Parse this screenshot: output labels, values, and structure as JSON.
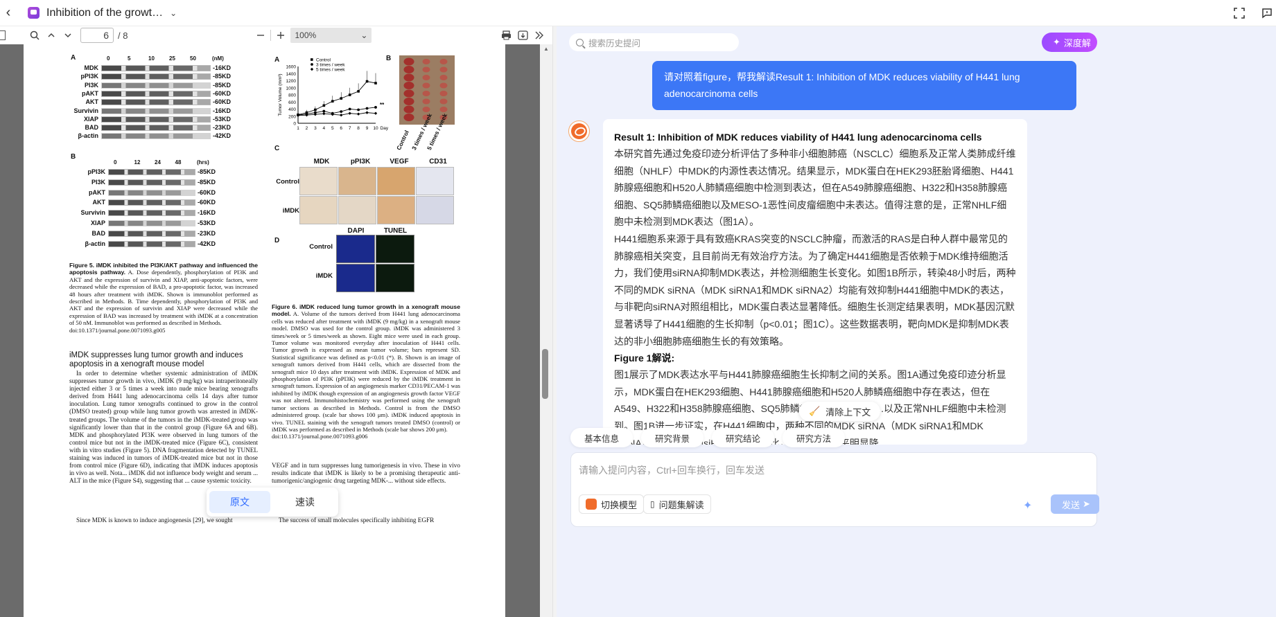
{
  "topbar": {
    "doc_title": "Inhibition of the growt…"
  },
  "pdf_toolbar": {
    "page_current": "6",
    "page_total": "/ 8",
    "zoom": "100%"
  },
  "figure5": {
    "panel_a": "A",
    "panel_b": "B",
    "doses": [
      "0",
      "5",
      "10",
      "25",
      "50",
      "(nM)"
    ],
    "rows_a": [
      {
        "name": "MDK",
        "kd": "-16KD"
      },
      {
        "name": "pPI3K",
        "kd": "-85KD"
      },
      {
        "name": "PI3K",
        "kd": "-85KD"
      },
      {
        "name": "pAKT",
        "kd": "-60KD"
      },
      {
        "name": "AKT",
        "kd": "-60KD"
      },
      {
        "name": "Survivin",
        "kd": "-16KD"
      },
      {
        "name": "XIAP",
        "kd": "-53KD"
      },
      {
        "name": "BAD",
        "kd": "-23KD"
      },
      {
        "name": "β-actin",
        "kd": "-42KD"
      }
    ],
    "times": [
      "0",
      "12",
      "24",
      "48",
      "(hrs)"
    ],
    "rows_b": [
      {
        "name": "pPI3K",
        "kd": "-85KD"
      },
      {
        "name": "PI3K",
        "kd": "-85KD"
      },
      {
        "name": "pAKT",
        "kd": "-60KD"
      },
      {
        "name": "AKT",
        "kd": "-60KD"
      },
      {
        "name": "Survivin",
        "kd": "-16KD"
      },
      {
        "name": "XIAP",
        "kd": "-53KD"
      },
      {
        "name": "BAD",
        "kd": "-23KD"
      },
      {
        "name": "β-actin",
        "kd": "-42KD"
      }
    ],
    "caption_title": "Figure 5. iMDK inhibited the PI3K/AKT pathway and influenced the apoptosis pathway.",
    "caption_body": "A. Dose dependently, phosphorylation of PI3K and AKT and the expression of survivin and XIAP, anti-apoptotic factors, were decreased while the expression of BAD, a pro-apoptotic factor, was increased 48 hours after treatment with iMDK. Shown is immunoblot performed as described in Methods. B. Time dependently, phosphorylation of PI3K and AKT and the expression of survivin and XIAP were decreased while the expression of BAD was increased by treatment with iMDK at a concentration of 50 nM. Immunoblot was performed as described in Methods.",
    "doi": "doi:10.1371/journal.pone.0071093.g005"
  },
  "section": {
    "heading": "iMDK suppresses lung tumor growth and induces apoptosis in a xenograft mouse model",
    "body": "In order to determine whether systemic administration of iMDK suppresses tumor growth in vivo, iMDK (9 mg/kg) was intraperitoneally injected either 3 or 5 times a week into nude mice bearing xenografts derived from H441 lung adenocarcinoma cells 14 days after tumor inoculation. Lung tumor xenografts continued to grow in the control (DMSO treated) group while lung tumor growth was arrested in iMDK-treated groups. The volume of the tumors in the iMDK-treated group was significantly lower than that in the control group (Figure 6A and 6B). MDK and phosphorylated PI3K were observed in lung tumors of the control mice but not in the iMDK-treated mice (Figure 6C), consistent with in vitro studies (Figure 5). DNA fragmentation detected by TUNEL staining was induced in tumors of iMDK-treated mice but not in those from control mice (Figure 6D), indicating that iMDK induces apoptosis in vivo as well. Nota... iMDK did not influence body weight and serum ... ALT in the mice (Figure S4), suggesting that ... cause systemic toxicity.",
    "body_last": "Since MDK is known to induce angiogenesis [29], we sought"
  },
  "figure6": {
    "panel_a": "A",
    "panel_b": "B",
    "panel_c": "C",
    "panel_d": "D",
    "legend": [
      "Control",
      "3 times / week",
      "5 times / week"
    ],
    "ylabel": "Tumor Volume (mm³)",
    "xlabel": "Days",
    "sig": "**",
    "photo_labels": [
      "Control",
      "3 times / week",
      "5 times / week"
    ],
    "ihc_cols": [
      "MDK",
      "pPI3K",
      "VEGF",
      "CD31"
    ],
    "ihc_rows": [
      "Control",
      "iMDK"
    ],
    "tunel_cols": [
      "DAPI",
      "TUNEL"
    ],
    "tunel_rows": [
      "Control",
      "iMDK"
    ],
    "caption_title": "Figure 6. iMDK reduced lung tumor growth in a xenograft mouse model.",
    "caption_body": "A. Volume of the tumors derived from H441 lung adenocarcinoma cells was reduced after treatment with iMDK (9 mg/kg) in a xenograft mouse model. DMSO was used for the control group. iMDK was administered 3 times/week or 5 times/week as shown. Eight mice were used in each group. Tumor volume was monitored everyday after inoculation of H441 cells. Tumor growth is expressed as mean tumor volume; bars represent SD. Statistical significance was defined as p<0.01 (*). B. Shown is an image of xenograft tumors derived from H441 cells, which are dissected from the xenograft mice 10 days after treatment with iMDK. Expression of MDK and phosphorylation of PI3K (pPI3K) were reduced by the iMDK treatment in xenograft tumors. Expression of an angiogenesis marker CD31/PECAM-1 was inhibited by iMDK though expression of an angiogenesis growth factor VEGF was not altered. Immunohistochemistry was performed using the xenograft tumor sections as described in Methods. Control is from the DMSO administered group. (scale bar shows 100 μm). iMDK induced apoptosis in vivo. TUNEL staining with the xenograft tumors treated DMSO (control) or iMDK was performed as described in Methods (scale bar shows 200 μm).",
    "doi": "doi:10.1371/journal.pone.0071093.g006",
    "after_text": "VEGF and in turn suppresses lung tumorigenesis in vivo. These in vivo results indicate that iMDK is likely to be a promising therapeutic anti-tumorigenic/angiogenic drug targeting MDK-... without side effects.",
    "after_text2": "The success of small molecules specifically inhibiting EGFR"
  },
  "chart_data": {
    "type": "line",
    "x": [
      1,
      2,
      3,
      4,
      5,
      6,
      7,
      8,
      9,
      10
    ],
    "xlabel": "Days",
    "ylabel": "Tumor Volume (mm³)",
    "ylim": [
      0,
      1600
    ],
    "yticks": [
      0,
      200,
      400,
      600,
      800,
      1000,
      1200,
      1400,
      1600
    ],
    "series": [
      {
        "name": "Control",
        "values": [
          240,
          300,
          380,
          500,
          620,
          700,
          800,
          900,
          1180,
          1130
        ]
      },
      {
        "name": "3 times / week",
        "values": [
          230,
          260,
          300,
          340,
          280,
          330,
          400,
          380,
          420,
          450
        ]
      },
      {
        "name": "5 times / week",
        "values": [
          220,
          230,
          250,
          270,
          250,
          230,
          280,
          260,
          300,
          280
        ]
      }
    ]
  },
  "view_toggle": {
    "original": "原文",
    "speed": "速读"
  },
  "chat": {
    "search_placeholder": "搜索历史提问",
    "deep_button": "深度解",
    "user_message": "请对照着figure，帮我解读Result 1: Inhibition of MDK reduces viability of H441 lung adenocarcinoma cells",
    "answer_title": "Result 1: Inhibition of MDK reduces viability of H441 lung adenocarcinoma cells",
    "answer_p1": "本研究首先通过免疫印迹分析评估了多种非小细胞肺癌（NSCLC）细胞系及正常人类肺成纤维细胞（NHLF）中MDK的内源性表达情况。结果显示，MDK蛋白在HEK293胚胎肾细胞、H441肺腺癌细胞和H520人肺鳞癌细胞中检测到表达，但在A549肺腺癌细胞、H322和H358肺腺癌细胞、SQ5肺鳞癌细胞以及MESO-1恶性间皮瘤细胞中未表达。值得注意的是，正常NHLF细胞中未检测到MDK表达（图1A）。",
    "answer_p2": "H441细胞系来源于具有致癌KRAS突变的NSCLC肿瘤，而激活的RAS是白种人群中最常见的肺腺癌相关突变，且目前尚无有效治疗方法。为了确定H441细胞是否依赖于MDK维持细胞活力，我们使用siRNA抑制MDK表达，并检测细胞生长变化。如图1B所示，转染48小时后，两种不同的MDK siRNA（MDK siRNA1和MDK siRNA2）均能有效抑制H441细胞中MDK的表达，与非靶向siRNA对照组相比，MDK蛋白表达显著降低。细胞生长测定结果表明，MDK基因沉默显著诱导了H441细胞的生长抑制（p<0.01；图1C）。这些数据表明，靶向MDK是抑制MDK表达的非小细胞肺癌细胞生长的有效策略。",
    "answer_h2": "Figure 1解说:",
    "answer_p3": "图1展示了MDK表达水平与H441肺腺癌细胞生长抑制之间的关系。图1A通过免疫印迹分析显示，MDK蛋白在HEK293细胞、H441肺腺癌细胞和H520人肺鳞癌细胞中存在表达，但在A549、H322和H358肺腺癌细胞、SQ5肺鳞癌细胞、MESO-1...以及正常NHLF细胞中未检测到。图1B进一步证实，在H441细胞中，两种不同的MDK siRNA（MDK siRNA1和MDK siRNA2）...与非靶向siRNA对照组相比，MDK蛋白水平明显降",
    "clear_context": "清除上下文",
    "chips": [
      "基本信息",
      "研究背景",
      "研究结论",
      "研究方法"
    ],
    "input_placeholder": "请输入提问内容，Ctrl+回车换行，回车发送",
    "switch_model": "切换模型",
    "question_set": "问题集解读",
    "send": "发送"
  }
}
